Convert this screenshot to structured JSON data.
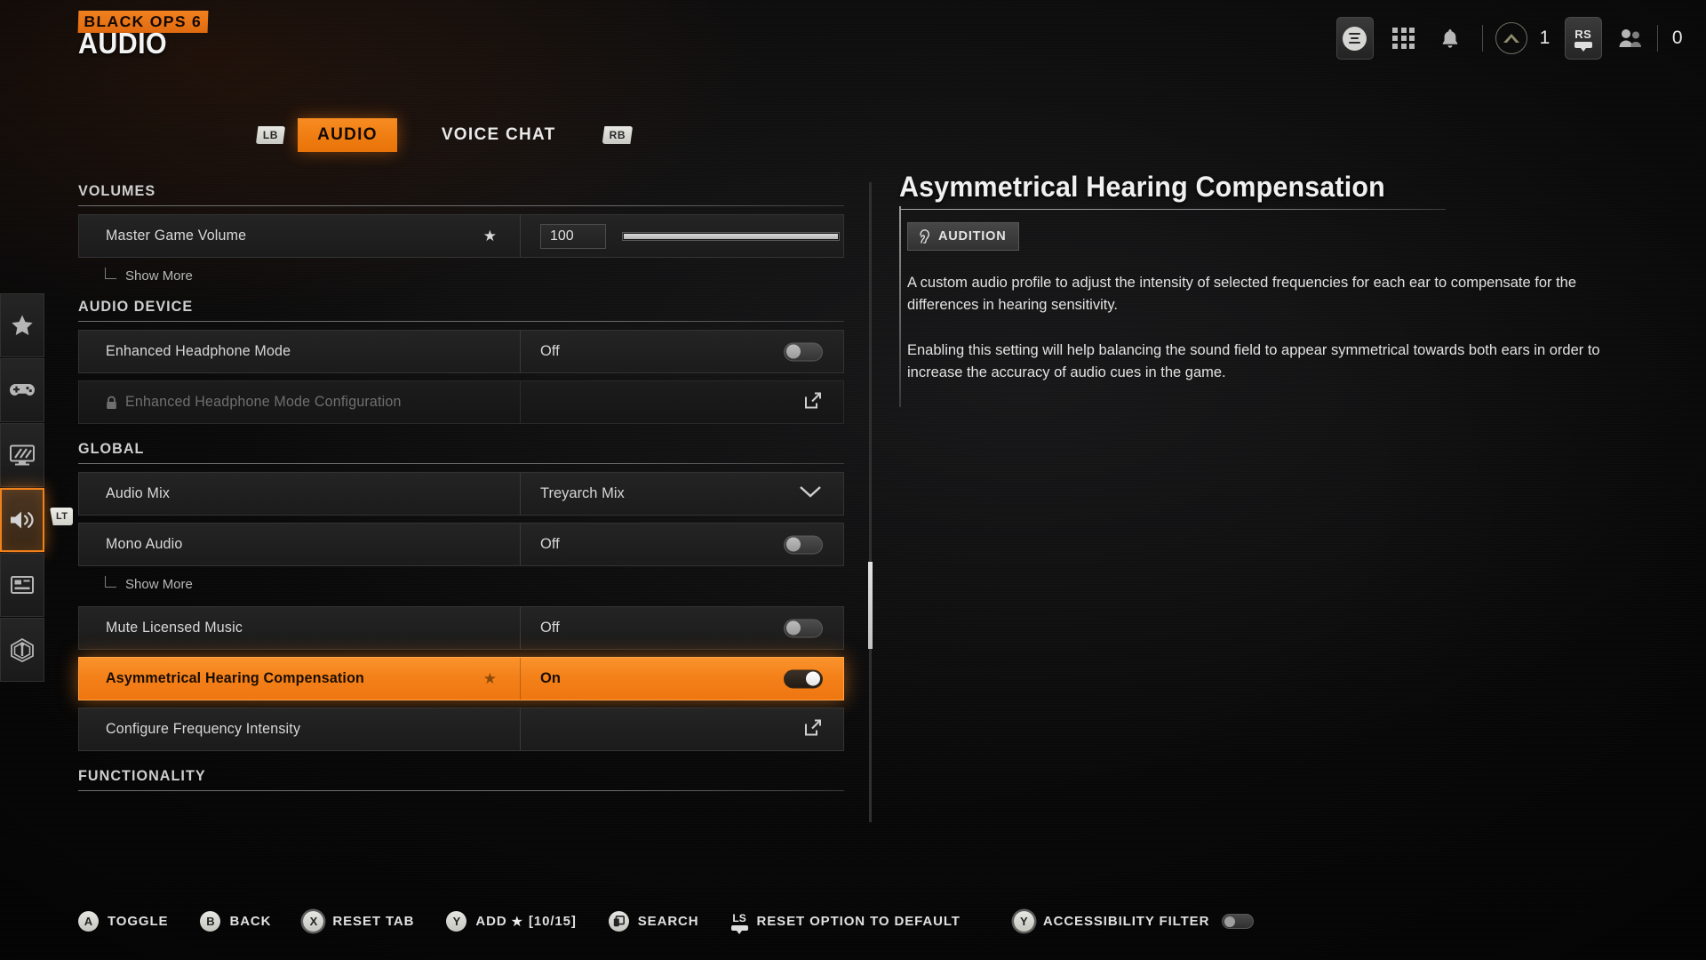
{
  "header": {
    "logo": "BLACK OPS 6",
    "title": "AUDIO",
    "icons": [
      "menu-icon",
      "apps-grid-icon",
      "bell-icon",
      "rank-triangle-icon",
      "rs-stick-icon",
      "party-people-icon"
    ],
    "rank_count": "1",
    "party_count": "0"
  },
  "tabs": {
    "left_bumper": "LB",
    "right_bumper": "RB",
    "items": [
      {
        "label": "AUDIO",
        "active": true
      },
      {
        "label": "VOICE CHAT",
        "active": false
      }
    ]
  },
  "sidebar": {
    "trigger_hint": "LT",
    "items": [
      {
        "name": "favorites",
        "icon": "star-icon",
        "active": false
      },
      {
        "name": "controller",
        "icon": "gamepad-icon",
        "active": false
      },
      {
        "name": "graphics",
        "icon": "monitor-icon",
        "active": false
      },
      {
        "name": "audio",
        "icon": "speaker-icon",
        "active": true
      },
      {
        "name": "interface",
        "icon": "hud-layout-icon",
        "active": false
      },
      {
        "name": "accessibility",
        "icon": "radar-icon",
        "active": false
      }
    ]
  },
  "settings": {
    "sections": [
      {
        "heading": "VOLUMES",
        "rows": [
          {
            "label": "Master Game Volume",
            "type": "slider",
            "value": "100",
            "favorited": true,
            "fill_percent": 100
          }
        ],
        "show_more": "Show More"
      },
      {
        "heading": "AUDIO DEVICE",
        "rows": [
          {
            "label": "Enhanced Headphone Mode",
            "type": "toggle",
            "value": "Off",
            "on": false
          },
          {
            "label": "Enhanced Headphone Mode Configuration",
            "type": "link",
            "value": "",
            "disabled": true,
            "locked": true
          }
        ]
      },
      {
        "heading": "GLOBAL",
        "rows": [
          {
            "label": "Audio Mix",
            "type": "dropdown",
            "value": "Treyarch Mix"
          },
          {
            "label": "Mono Audio",
            "type": "toggle",
            "value": "Off",
            "on": false
          }
        ],
        "show_more": "Show More",
        "rows_after": [
          {
            "label": "Mute Licensed Music",
            "type": "toggle",
            "value": "Off",
            "on": false
          },
          {
            "label": "Asymmetrical Hearing Compensation",
            "type": "toggle",
            "value": "On",
            "on": true,
            "favorited": true,
            "selected": true
          },
          {
            "label": "Configure Frequency Intensity",
            "type": "link",
            "value": ""
          }
        ]
      },
      {
        "heading": "FUNCTIONALITY",
        "rows": []
      }
    ]
  },
  "detail": {
    "title": "Asymmetrical Hearing Compensation",
    "badge": "AUDITION",
    "badge_icon": "ear-icon",
    "paragraph_1": "A custom audio profile to adjust the intensity of selected frequencies for each ear to compensate for the differences in hearing sensitivity.",
    "paragraph_2": "Enabling this setting will help balancing the sound field to appear symmetrical towards both ears in order to increase the accuracy of audio cues in the game."
  },
  "bottombar": {
    "hints": [
      {
        "glyph": "A",
        "label": "TOGGLE"
      },
      {
        "glyph": "B",
        "label": "BACK"
      },
      {
        "glyph": "X",
        "label": "RESET TAB"
      },
      {
        "glyph": "Y",
        "label": "ADD"
      },
      {
        "glyph": "",
        "label": "SEARCH"
      }
    ],
    "add_count": "[10/15]",
    "reset_option_label": "RESET OPTION TO DEFAULT",
    "reset_option_glyph": "LS",
    "accessibility_filter_label": "ACCESSIBILITY FILTER",
    "accessibility_filter_glyph": "Y",
    "accessibility_filter_on": false
  },
  "colors": {
    "accent": "#f0811c",
    "background": "#0a0a0a",
    "row_bg": "#222222",
    "text": "#e0e0e0"
  }
}
